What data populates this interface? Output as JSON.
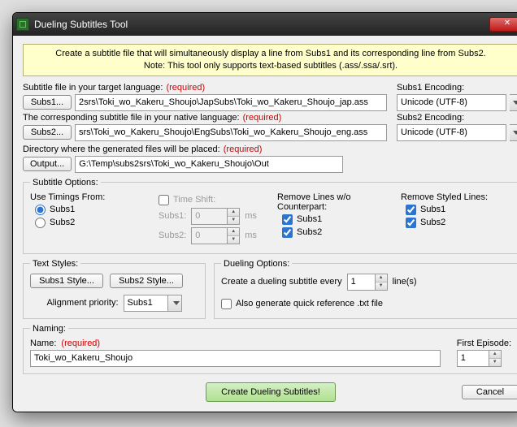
{
  "window": {
    "title": "Dueling Subtitles Tool"
  },
  "notice": {
    "line1": "Create a subtitle file that will simultaneously display a line from Subs1 and its corresponding line from Subs2.",
    "line2": "Note: This tool only supports text-based subtitles (.ass/.ssa/.srt)."
  },
  "labels": {
    "subs1": "Subtitle file in your target language:",
    "subs2": "The corresponding subtitle file in your native language:",
    "output": "Directory where the generated files will be placed:",
    "subs1enc": "Subs1 Encoding:",
    "subs2enc": "Subs2 Encoding:",
    "required": "(required)"
  },
  "buttons": {
    "subs1": "Subs1...",
    "subs2": "Subs2...",
    "output": "Output...",
    "s1style": "Subs1 Style...",
    "s2style": "Subs2 Style...",
    "create": "Create Dueling Subtitles!",
    "cancel": "Cancel"
  },
  "values": {
    "subs1path": "2srs\\Toki_wo_Kakeru_Shoujo\\JapSubs\\Toki_wo_Kakeru_Shoujo_jap.ass",
    "subs2path": "srs\\Toki_wo_Kakeru_Shoujo\\EngSubs\\Toki_wo_Kakeru_Shoujo_eng.ass",
    "outpath": "G:\\Temp\\subs2srs\\Toki_wo_Kakeru_Shoujo\\Out",
    "enc1": "Unicode (UTF-8)",
    "enc2": "Unicode (UTF-8)",
    "shift1": "0",
    "shift2": "0",
    "every": "1",
    "name": "Toki_wo_Kakeru_Shoujo",
    "firstep": "1",
    "alignsel": "Subs1"
  },
  "options": {
    "legend": "Subtitle Options:",
    "timings": "Use Timings From:",
    "timeshift": "Time Shift:",
    "remove": "Remove Lines w/o Counterpart:",
    "styled": "Remove Styled Lines:",
    "r_subs1": "Subs1",
    "r_subs2": "Subs2",
    "ts_s1": "Subs1:",
    "ts_s2": "Subs2:",
    "ms": "ms"
  },
  "styles": {
    "legend": "Text Styles:",
    "align": "Alignment priority:"
  },
  "dueling": {
    "legend": "Dueling Options:",
    "createtext1": "Create a dueling subtitle every",
    "createtext2": "line(s)",
    "quickref": "Also generate quick reference .txt file"
  },
  "naming": {
    "legend": "Naming:",
    "name": "Name:",
    "firstep": "First Episode:"
  }
}
